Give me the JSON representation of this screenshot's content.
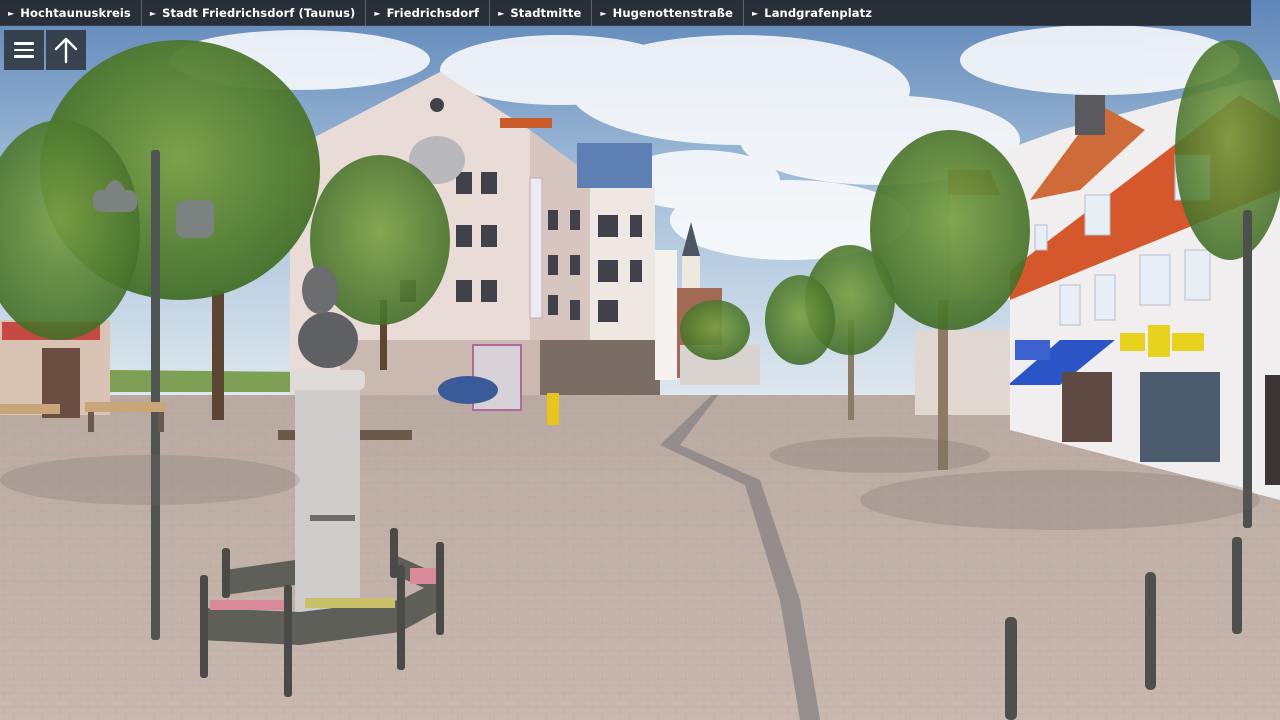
{
  "breadcrumb": {
    "items": [
      {
        "label": "Hochtaunuskreis"
      },
      {
        "label": "Stadt Friedrichsdorf (Taunus)"
      },
      {
        "label": "Friedrichsdorf"
      },
      {
        "label": "Stadtmitte"
      },
      {
        "label": "Hugenottenstraße"
      },
      {
        "label": "Landgrafenplatz"
      }
    ],
    "arrow_glyph": "►"
  },
  "controls": {
    "menu_icon": "hamburger-menu-icon",
    "north_icon": "arrow-up-icon"
  },
  "colors": {
    "bar_background": "#202226",
    "bar_text": "#ffffff",
    "sky": "#9fbcd8",
    "pavement": "#bfb0a8",
    "awning": "#2b54c6",
    "shop_sign": "#e7d21e"
  }
}
